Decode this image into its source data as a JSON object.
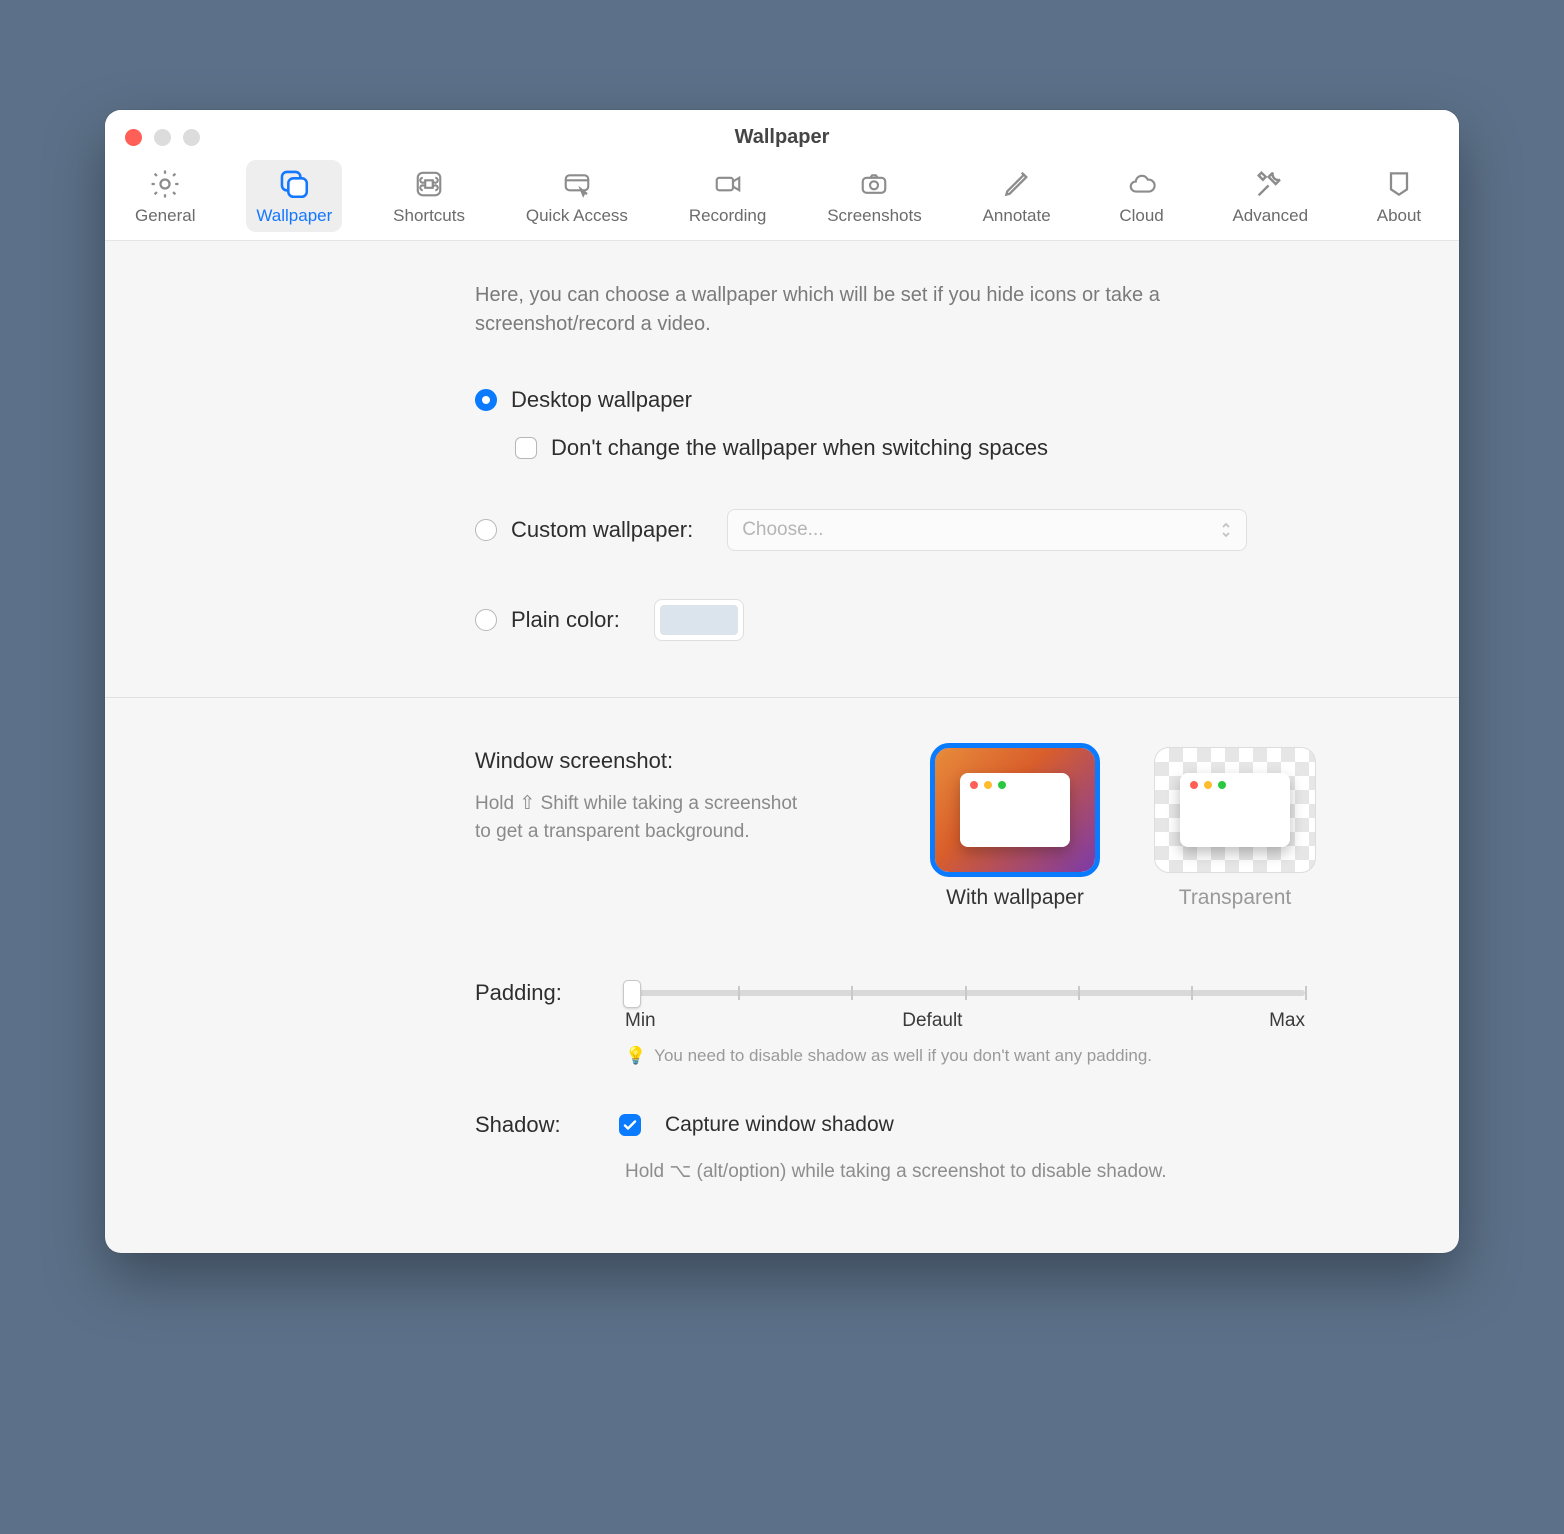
{
  "window": {
    "title": "Wallpaper"
  },
  "toolbar": {
    "items": [
      {
        "label": "General"
      },
      {
        "label": "Wallpaper"
      },
      {
        "label": "Shortcuts"
      },
      {
        "label": "Quick Access"
      },
      {
        "label": "Recording"
      },
      {
        "label": "Screenshots"
      },
      {
        "label": "Annotate"
      },
      {
        "label": "Cloud"
      },
      {
        "label": "Advanced"
      },
      {
        "label": "About"
      }
    ]
  },
  "intro": "Here, you can choose a wallpaper which will be set if you hide icons or take a screenshot/record a video.",
  "options": {
    "desktop": {
      "label": "Desktop wallpaper",
      "selected": true
    },
    "dont_change": {
      "label": "Don't change the wallpaper when switching spaces",
      "checked": false
    },
    "custom": {
      "label": "Custom wallpaper:",
      "selected": false,
      "popup_placeholder": "Choose..."
    },
    "plain": {
      "label": "Plain color:",
      "selected": false,
      "color": "#dbe4ec"
    }
  },
  "screenshot": {
    "title": "Window screenshot:",
    "desc": "Hold ⇧ Shift while taking a screenshot to get a transparent background.",
    "thumbs": {
      "with_wallpaper": "With wallpaper",
      "transparent": "Transparent"
    }
  },
  "padding": {
    "label": "Padding:",
    "min": "Min",
    "default": "Default",
    "max": "Max",
    "hint_icon": "💡",
    "hint": "You need to disable shadow as well if you don't want any padding."
  },
  "shadow": {
    "label": "Shadow:",
    "checkbox_label": "Capture window shadow",
    "checked": true,
    "hint": "Hold ⌥ (alt/option) while taking a screenshot to disable shadow."
  }
}
